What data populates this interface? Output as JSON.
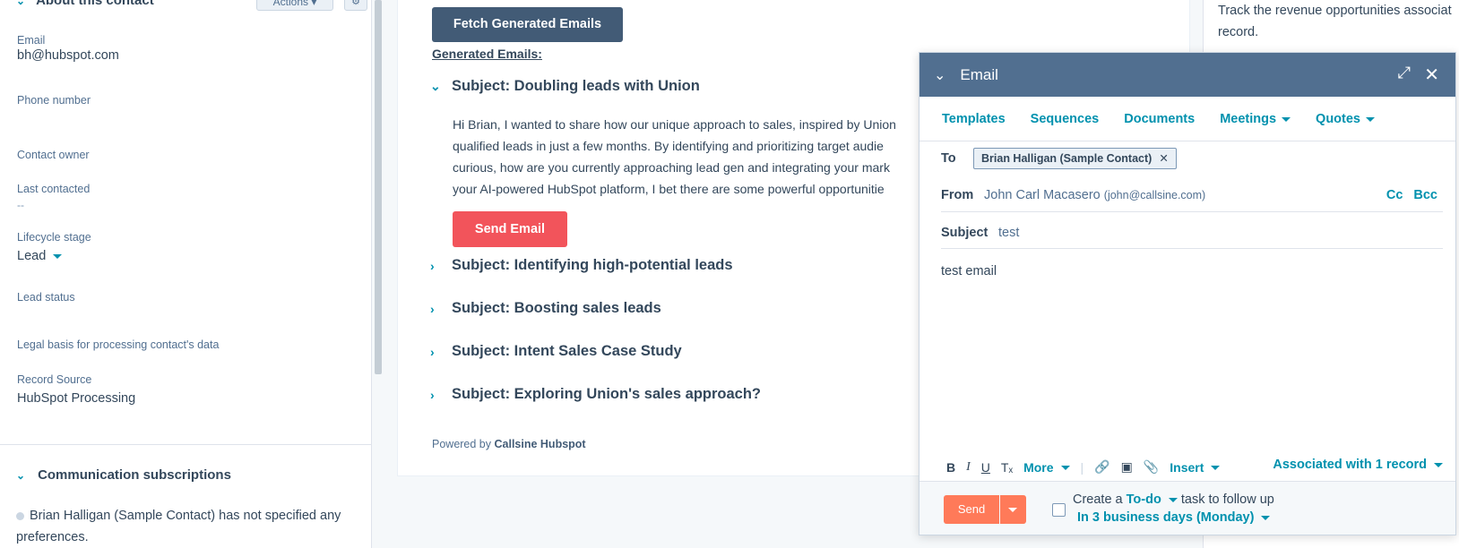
{
  "sidebar": {
    "section_title": "About this contact",
    "actions_label": "Actions",
    "properties": [
      {
        "label": "Email",
        "value": "bh@hubspot.com"
      },
      {
        "label": "Phone number",
        "value": ""
      },
      {
        "label": "Contact owner",
        "value": ""
      },
      {
        "label": "Last contacted",
        "value": "--"
      },
      {
        "label": "Lifecycle stage",
        "value": "Lead"
      },
      {
        "label": "Lead status",
        "value": ""
      },
      {
        "label": "Legal basis for processing contact's data",
        "value": ""
      },
      {
        "label": "Record Source",
        "value": "HubSpot Processing"
      }
    ],
    "comm_title": "Communication subscriptions",
    "comm_text": "Brian Halligan (Sample Contact) has not specified any preferences."
  },
  "main": {
    "fetch_button": "Fetch Generated Emails",
    "generated_title": "Generated Emails:",
    "emails": [
      {
        "subject": "Subject: Doubling leads with Union"
      },
      {
        "subject": "Subject: Identifying high-potential leads"
      },
      {
        "subject": "Subject: Boosting sales leads"
      },
      {
        "subject": "Subject: Intent Sales Case Study"
      },
      {
        "subject": "Subject: Exploring Union's sales approach?"
      }
    ],
    "body_lines": [
      "Hi Brian, I wanted to share how our unique approach to sales, inspired by Union",
      "qualified leads in just a few months. By identifying and prioritizing target audie",
      "curious, how are you currently approaching lead gen and integrating your mark",
      "your AI-powered HubSpot platform, I bet there are some powerful opportunitie"
    ],
    "send_button": "Send Email",
    "powered_prefix": "Powered by",
    "powered_brand": "Callsine Hubspot"
  },
  "right_panel": {
    "line1": "Track the revenue opportunities associat",
    "line2": "record."
  },
  "email_popup": {
    "title": "Email",
    "tabs": [
      "Templates",
      "Sequences",
      "Documents",
      "Meetings",
      "Quotes"
    ],
    "to_label": "To",
    "to_chip": "Brian Halligan (Sample Contact)",
    "from_label": "From",
    "from_name": "John Carl Macasero",
    "from_email": "(john@callsine.com)",
    "cc": "Cc",
    "bcc": "Bcc",
    "subject_label": "Subject",
    "subject_value": "test",
    "body": "test email",
    "toolbar_more": "More",
    "toolbar_insert": "Insert",
    "associated": "Associated with 1 record",
    "send": "Send",
    "task_create": "Create a",
    "task_type": "To-do",
    "task_suffix": "task to follow up",
    "task_when": "In 3 business days (Monday)"
  }
}
